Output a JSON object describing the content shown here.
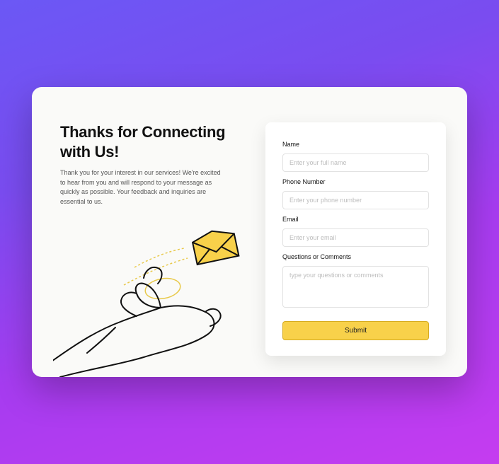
{
  "heading": "Thanks for Connecting with Us!",
  "description": "Thank you for your interest in our services! We're excited to hear from you and will respond to your message as quickly as possible. Your feedback and inquiries are essential to us.",
  "form": {
    "name": {
      "label": "Name",
      "placeholder": "Enter your full name",
      "value": ""
    },
    "phone": {
      "label": "Phone Number",
      "placeholder": "Enter your phone number",
      "value": ""
    },
    "email": {
      "label": "Email",
      "placeholder": "Enter your email",
      "value": ""
    },
    "comments": {
      "label": "Questions or Comments",
      "placeholder": "type your questions or comments",
      "value": ""
    },
    "submit_label": "Submit"
  },
  "colors": {
    "accent": "#f8d14a"
  }
}
